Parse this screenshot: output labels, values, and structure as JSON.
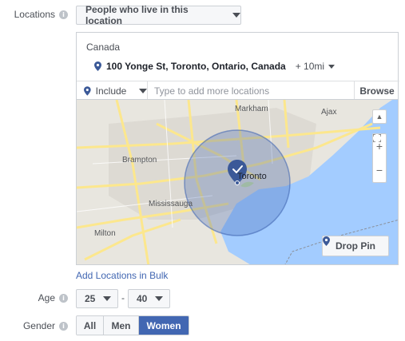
{
  "locations": {
    "label": "Locations",
    "audience_type": "People who live in this location",
    "country": "Canada",
    "selected_location": "100 Yonge St, Toronto, Ontario, Canada",
    "radius": "+ 10mi",
    "include_mode": "Include",
    "search_placeholder": "Type to add more locations",
    "browse_label": "Browse",
    "add_bulk_label": "Add Locations in Bulk"
  },
  "map": {
    "labels": {
      "markham": "Markham",
      "ajax": "Ajax",
      "brampton": "Brampton",
      "toronto": "Toronto",
      "mississauga": "Mississauga",
      "milton": "Milton"
    },
    "zoom_in": "+",
    "zoom_out": "−",
    "drop_pin_label": "Drop Pin",
    "colors": {
      "water": "#a3ccff",
      "land": "#e8e6df",
      "urban": "#dddad3",
      "road": "#fce78d",
      "radius_fill": "#4267b2",
      "pin": "#3b5998"
    }
  },
  "age": {
    "label": "Age",
    "min": "25",
    "separator": "-",
    "max": "40"
  },
  "gender": {
    "label": "Gender",
    "options": [
      "All",
      "Men",
      "Women"
    ],
    "selected": "Women"
  },
  "accent_color": "#4267b2"
}
